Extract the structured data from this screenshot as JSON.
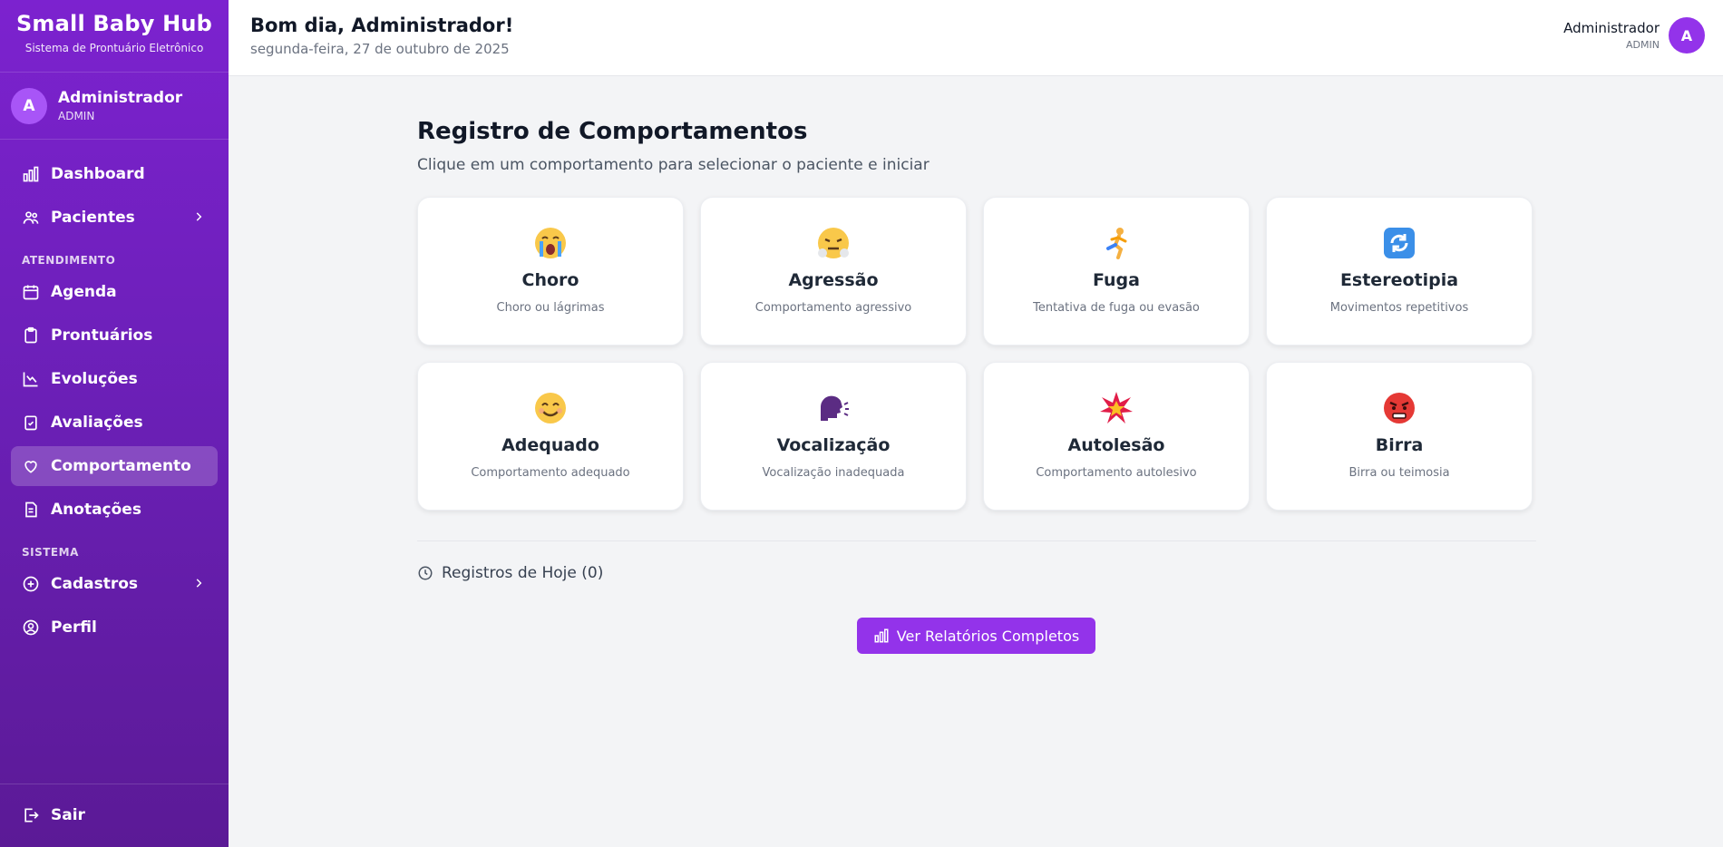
{
  "app": {
    "name": "Small Baby Hub",
    "subtitle": "Sistema de Prontuário Eletrônico"
  },
  "sidebar": {
    "user": {
      "initial": "A",
      "name": "Administrador",
      "role": "ADMIN"
    },
    "top_items": [
      {
        "label": "Dashboard",
        "icon": "bar-chart-icon"
      },
      {
        "label": "Pacientes",
        "icon": "users-icon",
        "has_submenu": true
      }
    ],
    "sections": [
      {
        "label": "ATENDIMENTO",
        "items": [
          {
            "label": "Agenda",
            "icon": "calendar-icon"
          },
          {
            "label": "Prontuários",
            "icon": "clipboard-icon"
          },
          {
            "label": "Evoluções",
            "icon": "chart-line-icon"
          },
          {
            "label": "Avaliações",
            "icon": "clipboard-check-icon"
          },
          {
            "label": "Comportamento",
            "icon": "heart-icon",
            "active": true
          },
          {
            "label": "Anotações",
            "icon": "file-text-icon"
          }
        ]
      },
      {
        "label": "SISTEMA",
        "items": [
          {
            "label": "Cadastros",
            "icon": "plus-circle-icon",
            "has_submenu": true
          },
          {
            "label": "Perfil",
            "icon": "user-circle-icon"
          }
        ]
      }
    ],
    "logout_label": "Sair"
  },
  "header": {
    "greeting": "Bom dia, Administrador!",
    "date": "segunda-feira, 27 de outubro de 2025",
    "user_name": "Administrador",
    "user_role": "ADMIN",
    "user_initial": "A"
  },
  "main": {
    "title": "Registro de Comportamentos",
    "subtitle": "Clique em um comportamento para selecionar o paciente e iniciar",
    "behaviors": [
      {
        "name": "Choro",
        "desc": "Choro ou lágrimas",
        "icon": "crying-face-icon"
      },
      {
        "name": "Agressão",
        "desc": "Comportamento agressivo",
        "icon": "steam-face-icon"
      },
      {
        "name": "Fuga",
        "desc": "Tentativa de fuga ou evasão",
        "icon": "running-person-icon"
      },
      {
        "name": "Estereotipia",
        "desc": "Movimentos repetitivos",
        "icon": "repeat-arrows-icon"
      },
      {
        "name": "Adequado",
        "desc": "Comportamento adequado",
        "icon": "smiling-face-icon"
      },
      {
        "name": "Vocalização",
        "desc": "Vocalização inadequada",
        "icon": "speaking-head-icon"
      },
      {
        "name": "Autolesão",
        "desc": "Comportamento autolesivo",
        "icon": "collision-icon"
      },
      {
        "name": "Birra",
        "desc": "Birra ou teimosia",
        "icon": "angry-face-icon"
      }
    ],
    "today_label": "Registros de Hoje (0)",
    "report_button": "Ver Relatórios Completos"
  },
  "colors": {
    "sidebar_top": "#7c22cf",
    "sidebar_bottom": "#5b1a96",
    "accent": "#9333ea"
  }
}
